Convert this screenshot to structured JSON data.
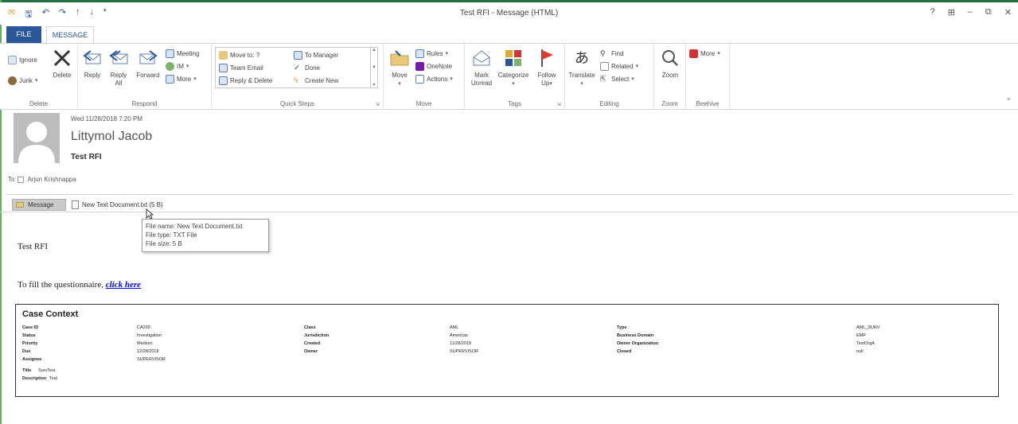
{
  "window": {
    "title": "Test RFI - Message (HTML)",
    "controls": [
      "?",
      "⊞",
      "–",
      "⧉",
      "✕"
    ]
  },
  "tabs": [
    {
      "label": "FILE"
    },
    {
      "label": "MESSAGE"
    }
  ],
  "ribbon": {
    "delete": {
      "group_label": "Delete",
      "ignore": "Ignore",
      "junk": "Junk",
      "delete": "Delete"
    },
    "respond": {
      "group_label": "Respond",
      "reply": "Reply",
      "reply_all_1": "Reply",
      "reply_all_2": "All",
      "forward": "Forward",
      "meeting": "Meeting",
      "im": "IM",
      "more": "More"
    },
    "quick_steps": {
      "group_label": "Quick Steps",
      "move_to": "Move to: ?",
      "team_email": "Team Email",
      "reply_delete": "Reply & Delete",
      "to_manager": "To Manager",
      "done": "Done",
      "create_new": "Create New"
    },
    "move": {
      "group_label": "Move",
      "move": "Move",
      "rules": "Rules",
      "onenote": "OneNote",
      "actions": "Actions"
    },
    "tags": {
      "group_label": "Tags",
      "mark_unread_1": "Mark",
      "mark_unread_2": "Unread",
      "categorize": "Categorize",
      "follow_up_1": "Follow",
      "follow_up_2": "Up"
    },
    "editing": {
      "group_label": "Editing",
      "translate": "Translate",
      "find": "Find",
      "related": "Related",
      "select": "Select"
    },
    "zoom": {
      "group_label": "Zoom",
      "zoom": "Zoom"
    },
    "beehive": {
      "group_label": "Beehive",
      "more": "More"
    }
  },
  "message": {
    "date": "Wed 11/28/2018 7:20 PM",
    "sender": "Littymol Jacob",
    "subject": "Test RFI",
    "to_label": "To",
    "recipient": "Arjun Krishnappa"
  },
  "attachments": {
    "message_tab": "Message",
    "file_name": "New Text Document.txt (5 B)"
  },
  "tooltip": {
    "line1": "File name: New Text Document.txt",
    "line2": "File type: TXT File",
    "line3": "File size: 5 B"
  },
  "body": {
    "title": "Test RFI",
    "questionnaire_text": "To fill the questionnaire, ",
    "link_text": "click here"
  },
  "case_context": {
    "heading": "Case Context",
    "rows": [
      [
        {
          "l": "Case ID",
          "v": "CA265"
        },
        {
          "l": "Class",
          "v": "AML"
        },
        {
          "l": "Type",
          "v": "AML_SURV"
        }
      ],
      [
        {
          "l": "Status",
          "v": "Investigation"
        },
        {
          "l": "Jurisdiction",
          "v": "Americas"
        },
        {
          "l": "Business Domain",
          "v": "EMP"
        }
      ],
      [
        {
          "l": "Priority",
          "v": "Medium"
        },
        {
          "l": "Created",
          "v": "11/28/2018"
        },
        {
          "l": "Owner Organization",
          "v": "TestOrgA"
        }
      ],
      [
        {
          "l": "Due",
          "v": "12/28/2018"
        },
        {
          "l": "Owner",
          "v": "SUPERVISOR"
        },
        {
          "l": "Closed",
          "v": "null"
        }
      ],
      [
        {
          "l": "Assignee",
          "v": "SUPERVISOR"
        }
      ]
    ],
    "title_label": "Title",
    "title_value": "SurvTest",
    "description_label": "Description",
    "description_value": "Test"
  },
  "colors": {
    "accent": "#2b579a",
    "file_tab": "#2b579a",
    "status_green": "#217346",
    "link": "#0000ee",
    "beehive_red": "#d13438"
  }
}
